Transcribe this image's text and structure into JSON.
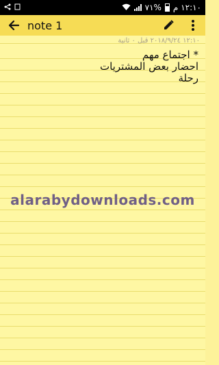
{
  "status_bar": {
    "time": "١٢:١٠ م",
    "battery": "٧١%"
  },
  "toolbar": {
    "title": "note 1"
  },
  "note": {
    "meta": "١٢:١٠ ٢٠١٨/٩/٢٤ قبل ٠ ثانية",
    "lines": [
      "* اجتماع مهم",
      "احضار بعض المشتريات",
      "رحلة"
    ]
  },
  "watermark": "alarabydownloads.com",
  "colors": {
    "toolbar_bg": "#f6dc55",
    "paper_bg": "#fef7a3",
    "rule_line": "#e9dd6d",
    "watermark": "#6f5f86"
  }
}
